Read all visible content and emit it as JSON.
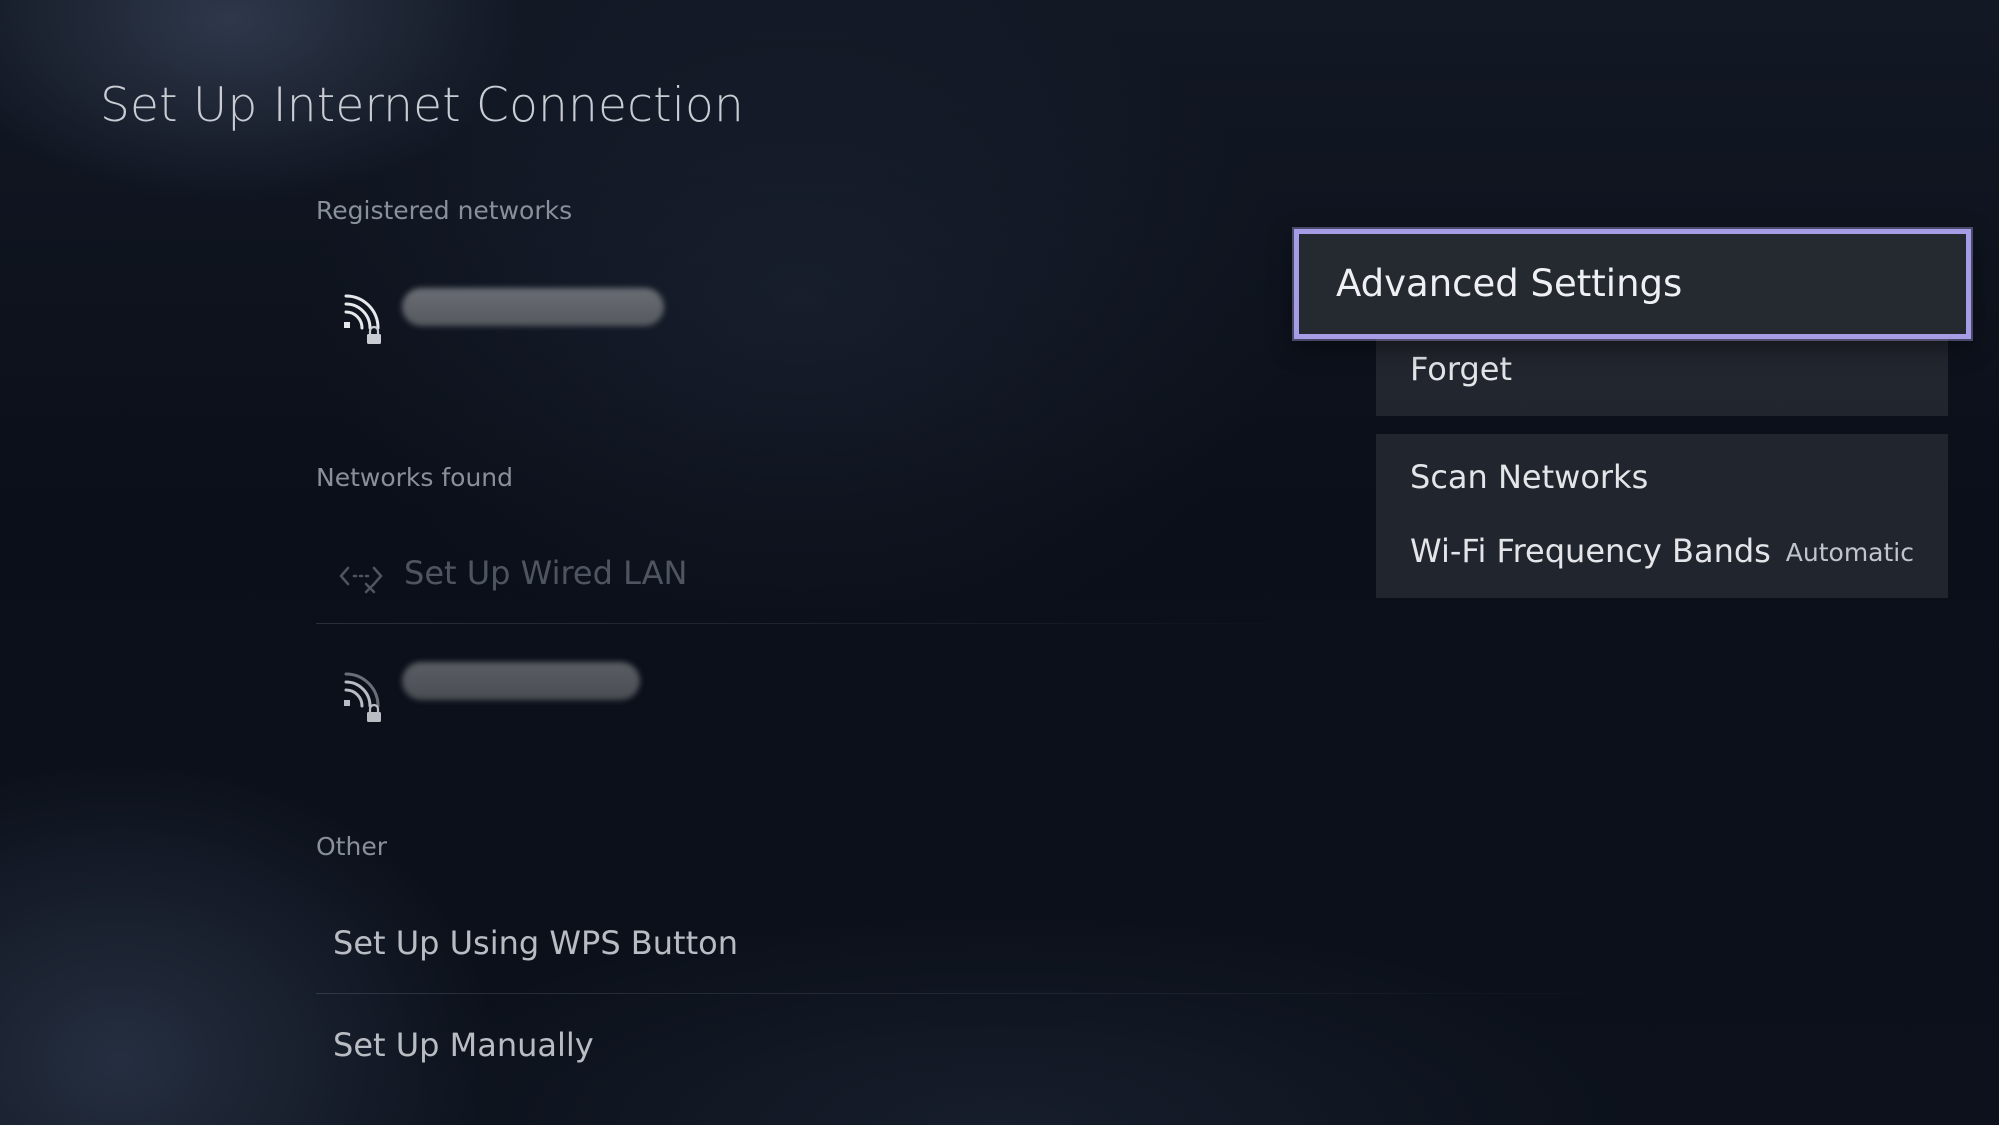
{
  "page": {
    "title": "Set Up Internet Connection"
  },
  "registered": {
    "label": "Registered networks",
    "network_icon": "wifi-locked-icon"
  },
  "found": {
    "label": "Networks found",
    "wired_lan": "Set Up Wired LAN",
    "wired_icon": "wired-lan-disconnected-icon",
    "network_icon": "wifi-locked-icon"
  },
  "other": {
    "label": "Other",
    "wps": "Set Up Using WPS Button",
    "manual": "Set Up Manually"
  },
  "menu": {
    "advanced_settings": "Advanced Settings",
    "forget": "Forget",
    "scan_networks": "Scan Networks",
    "wifi_bands_label": "Wi-Fi Frequency Bands",
    "wifi_bands_value": "Automatic"
  },
  "colors": {
    "focus_border": "#a79ce6",
    "menu_bg": "#24282f",
    "background": "#0a0e17"
  }
}
